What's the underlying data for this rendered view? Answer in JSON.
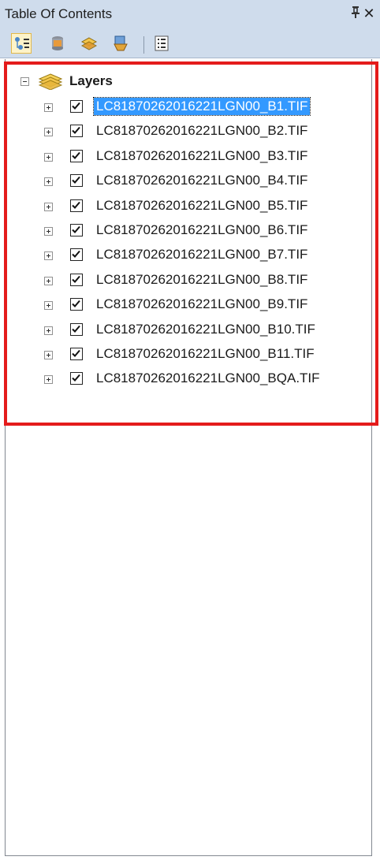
{
  "window": {
    "title": "Table Of Contents",
    "pin_glyph": "ᴪ",
    "close_glyph": "✕"
  },
  "toolbar": {
    "tools": [
      {
        "name": "list-by-drawing-order-icon",
        "active": true
      },
      {
        "name": "list-by-source-icon",
        "active": false
      },
      {
        "name": "list-by-visibility-icon",
        "active": false
      },
      {
        "name": "list-by-selection-icon",
        "active": false
      },
      {
        "name": "options-icon",
        "active": false
      }
    ]
  },
  "tree": {
    "root_label": "Layers",
    "layers": [
      {
        "name": "LC81870262016221LGN00_B1.TIF",
        "checked": true,
        "selected": true
      },
      {
        "name": "LC81870262016221LGN00_B2.TIF",
        "checked": true,
        "selected": false
      },
      {
        "name": "LC81870262016221LGN00_B3.TIF",
        "checked": true,
        "selected": false
      },
      {
        "name": "LC81870262016221LGN00_B4.TIF",
        "checked": true,
        "selected": false
      },
      {
        "name": "LC81870262016221LGN00_B5.TIF",
        "checked": true,
        "selected": false
      },
      {
        "name": "LC81870262016221LGN00_B6.TIF",
        "checked": true,
        "selected": false
      },
      {
        "name": "LC81870262016221LGN00_B7.TIF",
        "checked": true,
        "selected": false
      },
      {
        "name": "LC81870262016221LGN00_B8.TIF",
        "checked": true,
        "selected": false
      },
      {
        "name": "LC81870262016221LGN00_B9.TIF",
        "checked": true,
        "selected": false
      },
      {
        "name": "LC81870262016221LGN00_B10.TIF",
        "checked": true,
        "selected": false
      },
      {
        "name": "LC81870262016221LGN00_B11.TIF",
        "checked": true,
        "selected": false
      },
      {
        "name": "LC81870262016221LGN00_BQA.TIF",
        "checked": true,
        "selected": false
      }
    ]
  },
  "colors": {
    "title_bar": "#cfdcec",
    "selection": "#3399ff",
    "highlight_border": "#e41b1b"
  }
}
